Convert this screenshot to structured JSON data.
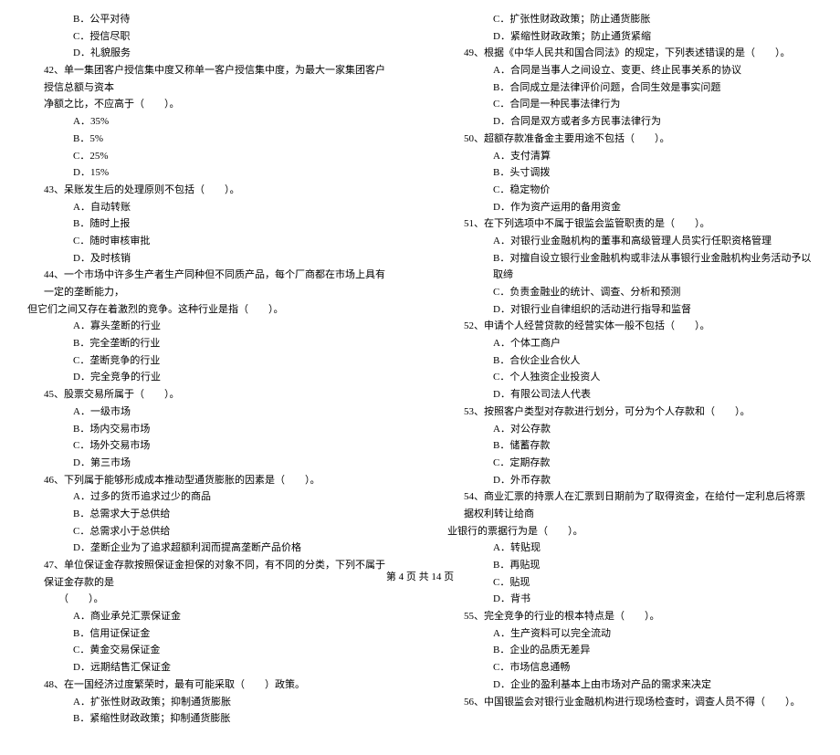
{
  "footer": "第 4 页 共 14 页",
  "left": {
    "pre_options": [
      "B．公平对待",
      "C．授信尽职",
      "D．礼貌服务"
    ],
    "questions": [
      {
        "num": "42、",
        "text": "单一集团客户授信集中度又称单一客户授信集中度，为最大一家集团客户授信总额与资本",
        "cont": [
          "净额之比，不应高于（　　）。"
        ],
        "options": [
          "A．35%",
          "B．5%",
          "C．25%",
          "D．15%"
        ]
      },
      {
        "num": "43、",
        "text": "呆账发生后的处理原则不包括（　　）。",
        "options": [
          "A．自动转账",
          "B．随时上报",
          "C．随时审核审批",
          "D．及时核销"
        ]
      },
      {
        "num": "44、",
        "text": "一个市场中许多生产者生产同种但不同质产品，每个厂商都在市场上具有一定的垄断能力，",
        "cont": [
          "但它们之间又存在着激烈的竞争。这种行业是指（　　）。"
        ],
        "cont_left": true,
        "options": [
          "A．寡头垄断的行业",
          "B．完全垄断的行业",
          "C．垄断竞争的行业",
          "D．完全竞争的行业"
        ]
      },
      {
        "num": "45、",
        "text": "股票交易所属于（　　）。",
        "options": [
          "A．一级市场",
          "B．场内交易市场",
          "C．场外交易市场",
          "D．第三市场"
        ]
      },
      {
        "num": "46、",
        "text": "下列属于能够形成成本推动型通货膨胀的因素是（　　）。",
        "options": [
          "A．过多的货币追求过少的商品",
          "B．总需求大于总供给",
          "C．总需求小于总供给",
          "D．垄断企业为了追求超额利润而提高垄断产品价格"
        ]
      },
      {
        "num": "47、",
        "text": "单位保证金存款按照保证金担保的对象不同，有不同的分类，下列不属于保证金存款的是",
        "cont": [
          "（　　）。"
        ],
        "cont_indent": true,
        "options": [
          "A．商业承兑汇票保证金",
          "B．信用证保证金",
          "C．黄金交易保证金",
          "D．远期结售汇保证金"
        ]
      },
      {
        "num": "48、",
        "text": "在一国经济过度繁荣时，最有可能采取（　　）政策。",
        "options": [
          "A．扩张性财政政策；抑制通货膨胀",
          "B．紧缩性财政政策；抑制通货膨胀"
        ]
      }
    ]
  },
  "right": {
    "pre_options": [
      "C．扩张性财政政策；防止通货膨胀",
      "D．紧缩性财政政策；防止通货紧缩"
    ],
    "questions": [
      {
        "num": "49、",
        "text": "根据《中华人民共和国合同法》的规定，下列表述错误的是（　　）。",
        "options": [
          "A．合同是当事人之间设立、变更、终止民事关系的协议",
          "B．合同成立是法律评价问题，合同生效是事实问题",
          "C．合同是一种民事法律行为",
          "D．合同是双方或者多方民事法律行为"
        ]
      },
      {
        "num": "50、",
        "text": "超额存款准备金主要用途不包括（　　）。",
        "options": [
          "A．支付清算",
          "B．头寸调拨",
          "C．稳定物价",
          "D．作为资产运用的备用资金"
        ]
      },
      {
        "num": "51、",
        "text": "在下列选项中不属于银监会监管职责的是（　　）。",
        "options": [
          "A．对银行业金融机构的董事和高级管理人员实行任职资格管理",
          "B．对擅自设立银行业金融机构或非法从事银行业金融机构业务活动予以取缔",
          "C．负责金融业的统计、调查、分析和预测",
          "D．对银行业自律组织的活动进行指导和监督"
        ]
      },
      {
        "num": "52、",
        "text": "申请个人经营贷款的经营实体一般不包括（　　）。",
        "options": [
          "A．个体工商户",
          "B．合伙企业合伙人",
          "C．个人独资企业投资人",
          "D．有限公司法人代表"
        ]
      },
      {
        "num": "53、",
        "text": "按照客户类型对存款进行划分，可分为个人存款和（　　）。",
        "options": [
          "A．对公存款",
          "B．储蓄存款",
          "C．定期存款",
          "D．外币存款"
        ]
      },
      {
        "num": "54、",
        "text": "商业汇票的持票人在汇票到日期前为了取得资金，在给付一定利息后将票据权利转让给商",
        "cont": [
          "业银行的票据行为是（　　）。"
        ],
        "cont_left": true,
        "options": [
          "A．转贴现",
          "B．再贴现",
          "C．贴现",
          "D．背书"
        ]
      },
      {
        "num": "55、",
        "text": "完全竞争的行业的根本特点是（　　）。",
        "options": [
          "A．生产资料可以完全流动",
          "B．企业的品质无差异",
          "C．市场信息通畅",
          "D．企业的盈利基本上由市场对产品的需求来决定"
        ]
      },
      {
        "num": "56、",
        "text": "中国银监会对银行业金融机构进行现场检查时，调查人员不得（　　）。"
      }
    ]
  }
}
